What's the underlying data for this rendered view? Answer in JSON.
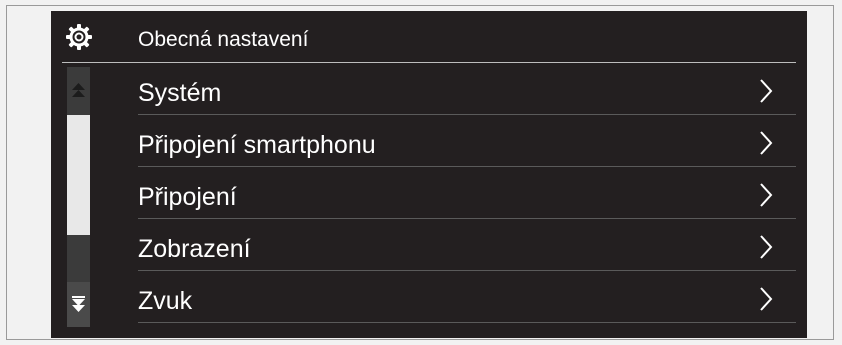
{
  "header": {
    "title": "Obecná nastavení",
    "icon": "gear-icon"
  },
  "menu": {
    "items": [
      {
        "label": "Systém",
        "icon": "chevron-right-icon"
      },
      {
        "label": "Připojení smartphonu",
        "icon": "chevron-right-icon"
      },
      {
        "label": "Připojení",
        "icon": "chevron-right-icon"
      },
      {
        "label": "Zobrazení",
        "icon": "chevron-right-icon"
      },
      {
        "label": "Zvuk",
        "icon": "chevron-right-icon"
      }
    ]
  },
  "scrollbar": {
    "up_icon": "scroll-up-icon",
    "down_icon": "scroll-down-icon"
  },
  "colors": {
    "screen_background": "#231f20",
    "text": "#ffffff",
    "scroll_thumb": "#e8e8e8",
    "page_background": "#f2f2f2"
  }
}
